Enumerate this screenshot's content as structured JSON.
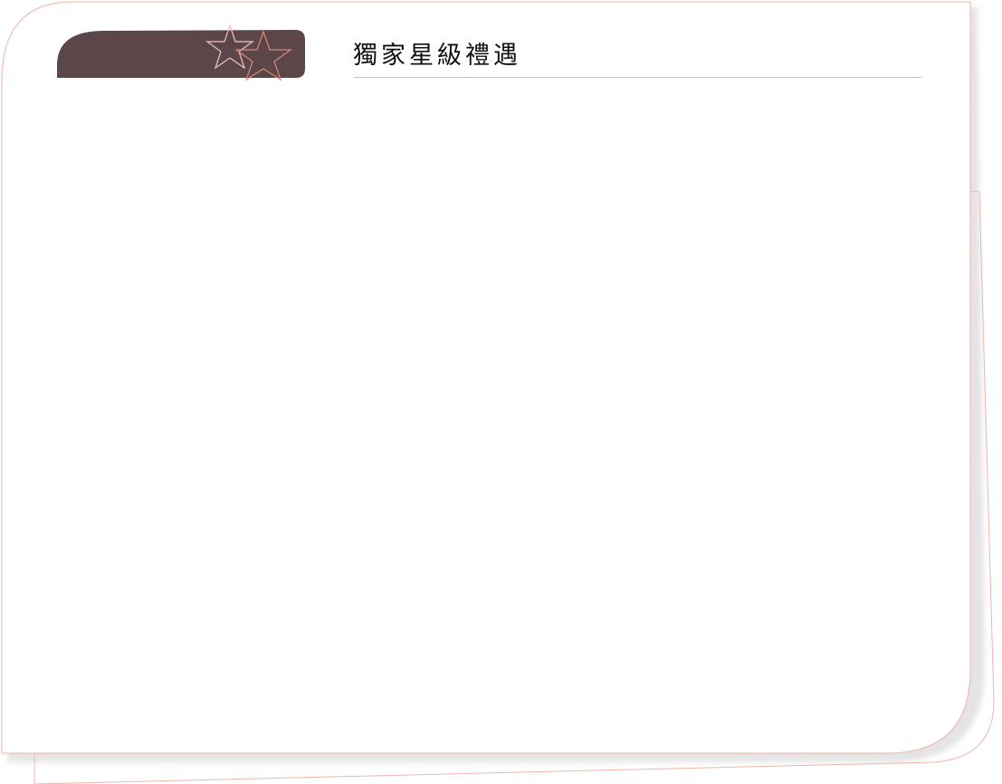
{
  "header": {
    "title": "獨家星級禮遇"
  },
  "colors": {
    "tab_fill": "#5b4749",
    "border_accent": "#f0b4a8",
    "star_outline_light": "#f3c4bd",
    "star_outline_accent": "#e0857b",
    "title_rule": "#e0b2ad"
  },
  "icons": {
    "decoration": [
      "star-icon",
      "star-icon"
    ]
  }
}
